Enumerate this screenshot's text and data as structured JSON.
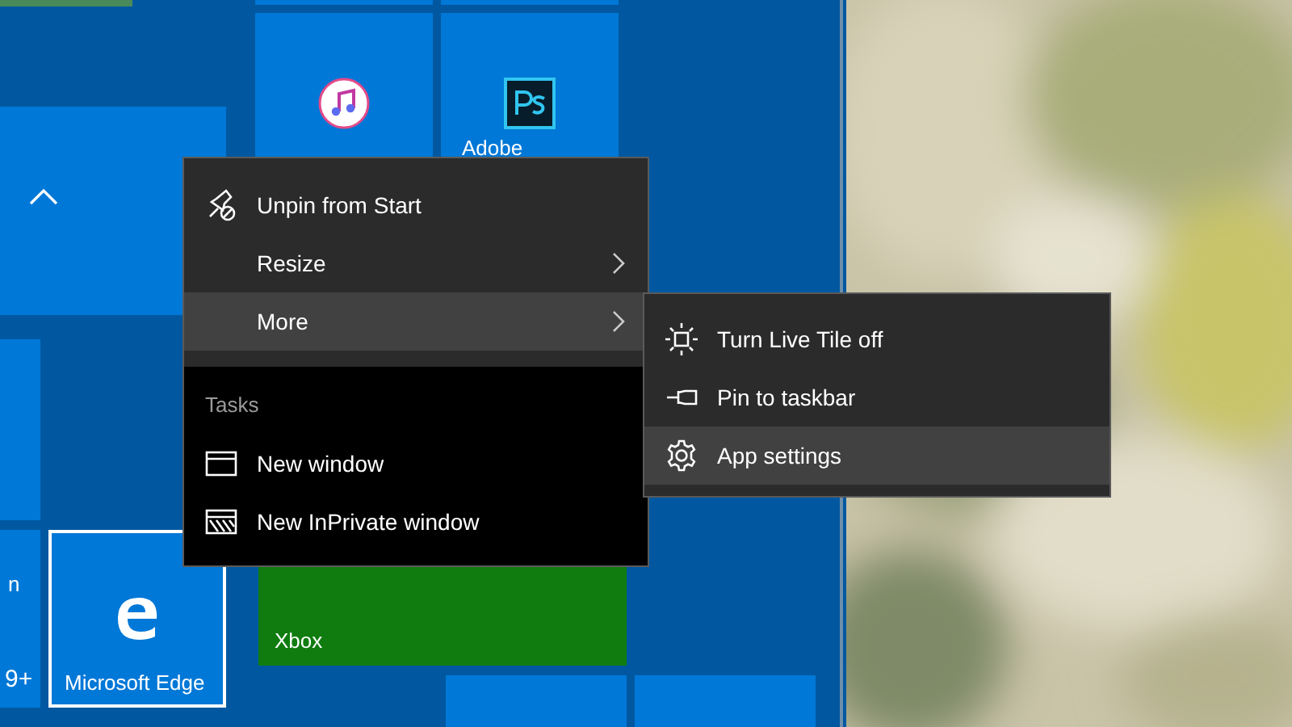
{
  "tiles": [
    {
      "color": "#4a8a5a",
      "selected": false
    },
    {
      "color": "#0078d7",
      "selected": false
    },
    {
      "color": "#0078d7",
      "selected": false
    },
    {
      "color": "#0078d7",
      "selected": false
    },
    {
      "color": "#0078d7",
      "selected": false
    },
    {
      "label": "Adobe",
      "color": "#0078d7",
      "selected": false
    },
    {
      "color": "#0078d7",
      "selected": false
    },
    {
      "label": "n",
      "badge": "9+",
      "color": "#0078d7",
      "selected": false
    },
    {
      "label": "Microsoft Edge",
      "color": "#0078d7",
      "selected": true
    },
    {
      "label": "Xbox",
      "color": "#107c10",
      "selected": false
    },
    {
      "color": "#0078d7",
      "selected": false
    },
    {
      "color": "#0078d7",
      "selected": false
    }
  ],
  "context_menu": {
    "items": [
      {
        "label": "Unpin from Start",
        "submenu": false,
        "selected": false
      },
      {
        "label": "Resize",
        "submenu": true,
        "selected": false
      },
      {
        "label": "More",
        "submenu": true,
        "selected": true
      }
    ],
    "tasks": [
      {
        "kind": "header",
        "label": "Tasks"
      },
      {
        "kind": "item",
        "label": "New window"
      },
      {
        "kind": "item",
        "label": "New InPrivate window"
      }
    ]
  },
  "submenu": {
    "items": [
      {
        "label": "Turn Live Tile off",
        "selected": false
      },
      {
        "label": "Pin to taskbar",
        "selected": false
      },
      {
        "label": "App settings",
        "selected": true
      }
    ]
  }
}
